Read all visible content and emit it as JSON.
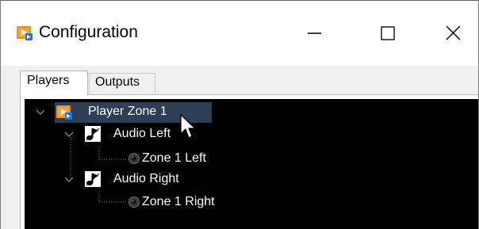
{
  "window": {
    "title": "Configuration",
    "controls": {
      "minimize": "minimize",
      "maximize": "maximize",
      "close": "close"
    },
    "app_icon": "configuration-app-icon",
    "accent_color": "#f28c1e"
  },
  "tabs": [
    {
      "label": "Players",
      "selected": true
    },
    {
      "label": "Outputs",
      "selected": false
    }
  ],
  "tree": {
    "background": "#000000",
    "root": {
      "label": "Player Zone 1",
      "icon": "player-icon",
      "expanded": true,
      "selected": true,
      "children": [
        {
          "label": "Audio Left",
          "icon": "audio-note-icon",
          "expanded": true,
          "children": [
            {
              "label": "Zone 1 Left",
              "icon": "speaker-dot-icon"
            }
          ]
        },
        {
          "label": "Audio Right",
          "icon": "audio-note-icon",
          "expanded": true,
          "children": [
            {
              "label": "Zone 1 Right",
              "icon": "speaker-dot-icon"
            }
          ]
        }
      ]
    }
  }
}
